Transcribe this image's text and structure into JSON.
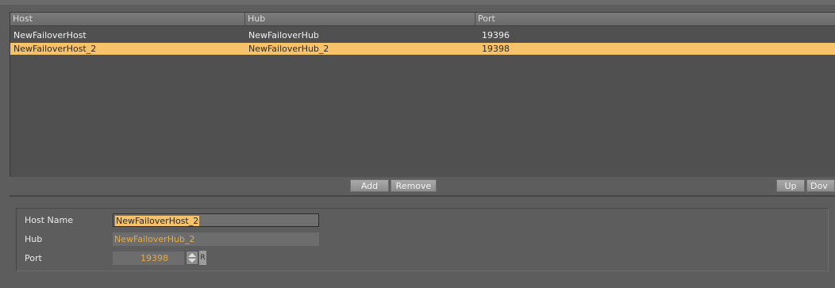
{
  "table": {
    "columns": [
      "Host",
      "Hub",
      "Port"
    ],
    "rows": [
      {
        "host": "NewFailoverHost",
        "hub": "NewFailoverHub",
        "port": "19396",
        "selected": false
      },
      {
        "host": "NewFailoverHost_2",
        "hub": "NewFailoverHub_2",
        "port": "19398",
        "selected": true
      }
    ]
  },
  "buttons": {
    "add": "Add",
    "remove": "Remove",
    "up": "Up",
    "down": "Dov"
  },
  "details": {
    "host_name_label": "Host Name",
    "host_name_value": "NewFailoverHost_2",
    "hub_label": "Hub",
    "hub_value": "NewFailoverHub_2",
    "port_label": "Port",
    "port_value": "19398",
    "reset_label": "R"
  },
  "colors": {
    "selection": "#f6c26a",
    "field_text": "#e8aa3e",
    "background": "#5d5d5d"
  }
}
